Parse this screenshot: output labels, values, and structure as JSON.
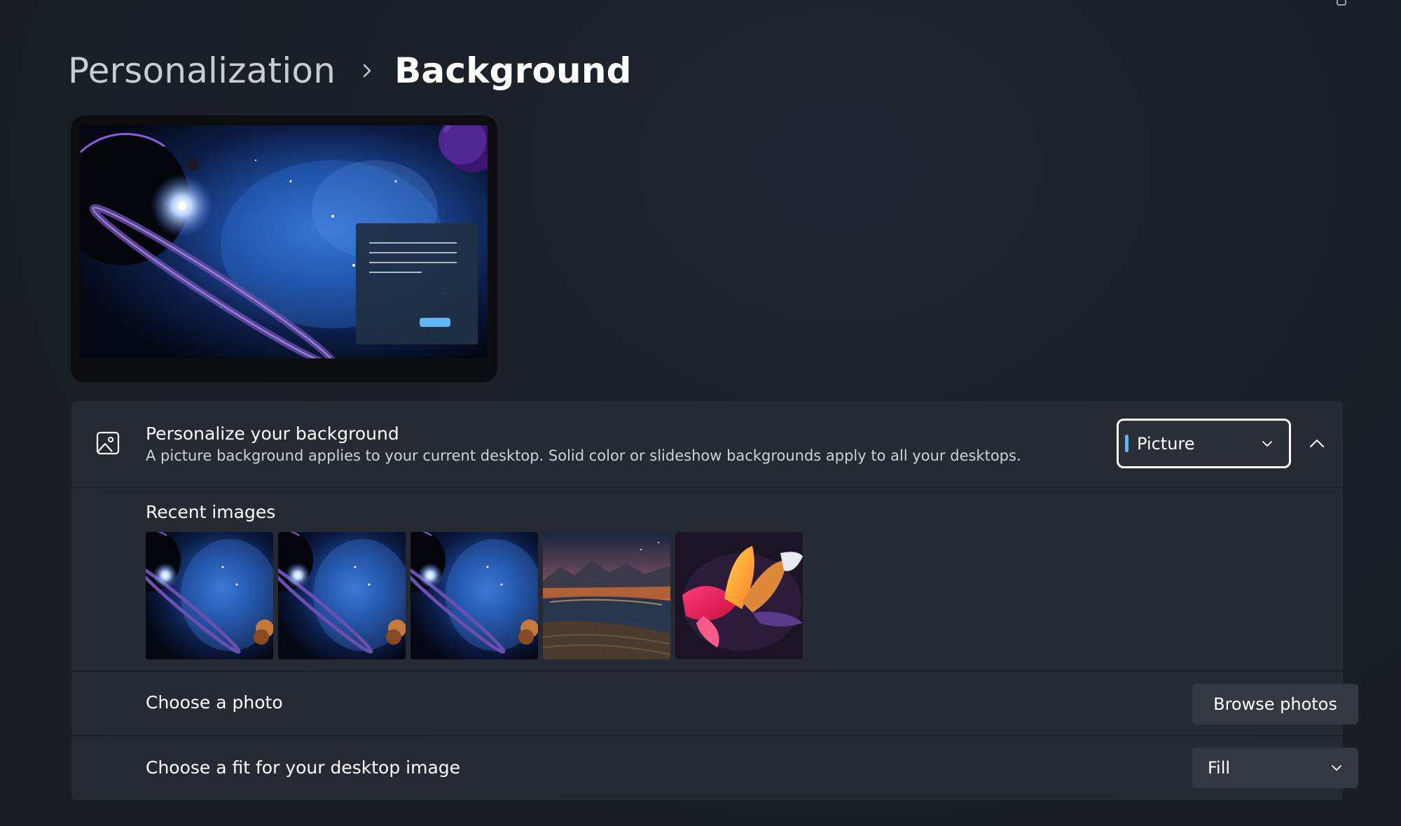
{
  "breadcrumb": {
    "parent": "Personalization",
    "current": "Background"
  },
  "personalize": {
    "title": "Personalize your background",
    "description": "A picture background applies to your current desktop. Solid color or slideshow backgrounds apply to all your desktops.",
    "dropdown_value": "Picture"
  },
  "recent": {
    "title": "Recent images",
    "thumbnails": [
      "space-galaxy",
      "space-galaxy",
      "space-galaxy",
      "mountain-lake",
      "abstract-flower"
    ]
  },
  "choose_photo": {
    "label": "Choose a photo",
    "button": "Browse photos"
  },
  "choose_fit": {
    "label": "Choose a fit for your desktop image",
    "dropdown_value": "Fill"
  },
  "colors": {
    "accent": "#5eb8f5",
    "card": "#262b33",
    "background": "#1b1f27"
  }
}
